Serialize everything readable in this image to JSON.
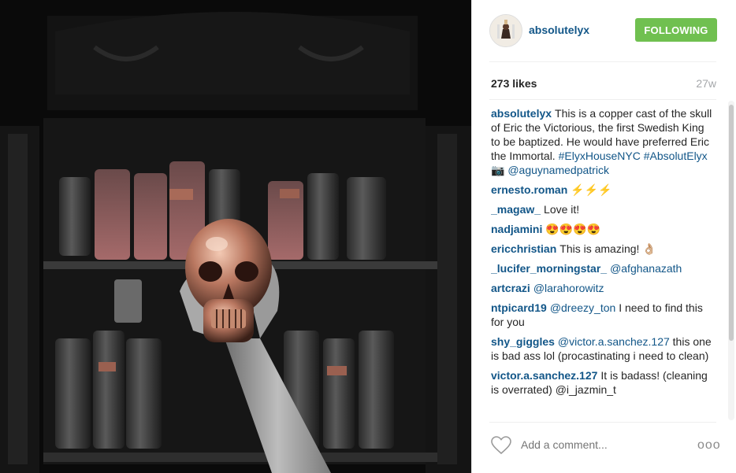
{
  "post": {
    "username": "absolutelyx",
    "follow_label": "FOLLOWING",
    "likes": "273 likes",
    "time_ago": "27w",
    "add_comment_placeholder": "Add a comment...",
    "more_label": "ooo"
  },
  "caption": {
    "author": "absolutelyx",
    "text": "This is a copper cast of the skull of Eric the Victorious, the first Swedish King to be baptized. He would have preferred Eric the Immortal.",
    "hashtags": "#ElyxHouseNYC #AbsolutElyx",
    "camera_emoji": "📷",
    "mention": "@aguynamedpatrick"
  },
  "comments": [
    {
      "author": "ernesto.roman",
      "mention": "",
      "text": "⚡⚡⚡"
    },
    {
      "author": "_magaw_",
      "mention": "",
      "text": "Love it!"
    },
    {
      "author": "nadjamini",
      "mention": "",
      "text": "😍😍😍😍"
    },
    {
      "author": "ericchristian",
      "mention": "",
      "text": "This is amazing! 👌🏼"
    },
    {
      "author": "_lucifer_morningstar_",
      "mention": "@afghanazath",
      "text": ""
    },
    {
      "author": "artcrazi",
      "mention": "@larahorowitz",
      "text": ""
    },
    {
      "author": "ntpicard19",
      "mention": "@dreezy_ton",
      "text": "I need to find this for you"
    },
    {
      "author": "shy_giggles",
      "mention": "@victor.a.sanchez.127",
      "text": "this one is bad ass lol (procastinating i need to clean)"
    },
    {
      "author": "victor.a.sanchez.127",
      "mention": "",
      "text": "It is badass! (cleaning is overrated) @i_jazmin_t"
    }
  ],
  "colors": {
    "link": "#125688",
    "follow_button": "#70c050",
    "text": "#262626",
    "muted": "#a5a7aa"
  },
  "icons": [
    "heart-icon",
    "more-options-icon",
    "avatar-image"
  ]
}
